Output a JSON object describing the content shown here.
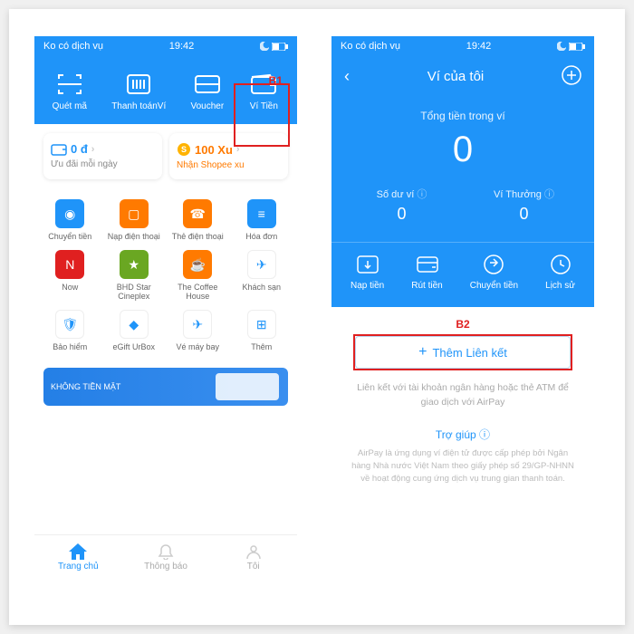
{
  "status": {
    "carrier": "Ko có dịch vụ",
    "time": "19:42"
  },
  "s1": {
    "label": "B1",
    "actions": [
      {
        "label": "Quét mã"
      },
      {
        "label": "Thanh toánVí"
      },
      {
        "label": "Voucher"
      },
      {
        "label": "Ví Tiền"
      }
    ],
    "card1": {
      "value": "0 đ",
      "sub": "Ưu đãi mỗi ngày"
    },
    "card2": {
      "value": "100 Xu",
      "sub": "Nhận Shopee xu"
    },
    "grid": [
      {
        "label": "Chuyển tiền",
        "color": "#1f94f9"
      },
      {
        "label": "Nạp điện thoại",
        "color": "#ff7a00"
      },
      {
        "label": "Thẻ điện thoại",
        "color": "#ff7a00"
      },
      {
        "label": "Hóa đơn",
        "color": "#1f94f9"
      },
      {
        "label": "Now",
        "color": "#e02020"
      },
      {
        "label": "BHD Star Cineplex",
        "color": "#6aa722"
      },
      {
        "label": "The Coffee House",
        "color": "#ff7a00"
      },
      {
        "label": "Khách sạn",
        "color": "#ffffff"
      },
      {
        "label": "Bảo hiểm",
        "color": "#ffffff"
      },
      {
        "label": "eGift UrBox",
        "color": "#ffffff"
      },
      {
        "label": "Vé máy bay",
        "color": "#ffffff"
      },
      {
        "label": "Thêm",
        "color": "#ffffff"
      }
    ],
    "promo": "KHÔNG TIỀN MẶT",
    "tabs": [
      {
        "label": "Trang chủ"
      },
      {
        "label": "Thông báo"
      },
      {
        "label": "Tôi"
      }
    ]
  },
  "s2": {
    "title": "Ví của tôi",
    "totalLabel": "Tổng tiền trong ví",
    "totalValue": "0",
    "balanceLabel": "Số dư ví",
    "balanceValue": "0",
    "bonusLabel": "Ví Thưởng",
    "bonusValue": "0",
    "actions": [
      {
        "label": "Nạp tiền"
      },
      {
        "label": "Rút tiền"
      },
      {
        "label": "Chuyển tiền"
      },
      {
        "label": "Lịch sử"
      }
    ],
    "b2": "B2",
    "linkBtn": "Thêm Liên kết",
    "sub": "Liên kết với tài khoản ngân hàng hoặc thẻ ATM để giao dịch với AirPay",
    "help": "Trợ giúp",
    "fine": "AirPay là ứng dụng ví điện tử được cấp phép bởi Ngân hàng Nhà nước Việt Nam theo giấy phép số 29/GP-NHNN về hoạt động cung ứng dịch vụ trung gian thanh toán."
  }
}
